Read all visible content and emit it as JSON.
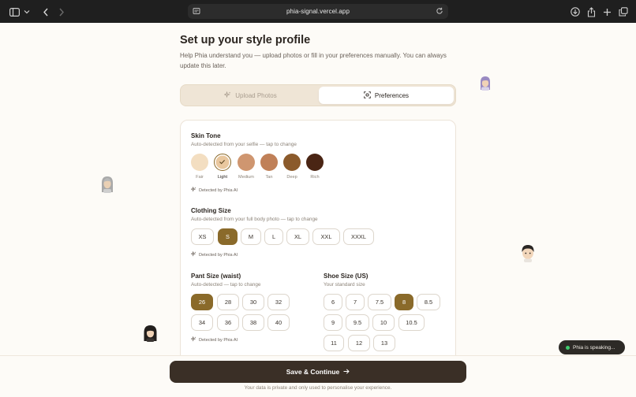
{
  "browser": {
    "url": "phia-signal.vercel.app"
  },
  "page": {
    "title": "Set up your style profile",
    "subtitle": "Help Phia understand you — upload photos or fill in your preferences manually. You can always update this later."
  },
  "tabs": [
    {
      "label": "Upload Photos",
      "icon": "sparkle-icon",
      "active": false
    },
    {
      "label": "Preferences",
      "icon": "scan-icon",
      "active": true
    }
  ],
  "skin_tone": {
    "heading": "Skin Tone",
    "description": "Auto-detected from your selfie — tap to change",
    "options": [
      {
        "label": "Fair",
        "color": "#f3dec1",
        "selected": false
      },
      {
        "label": "Light",
        "color": "#e9c79e",
        "selected": true
      },
      {
        "label": "Medium",
        "color": "#cf9670",
        "selected": false
      },
      {
        "label": "Tan",
        "color": "#c08058",
        "selected": false
      },
      {
        "label": "Deep",
        "color": "#8b5a2b",
        "selected": false
      },
      {
        "label": "Rich",
        "color": "#4a2514",
        "selected": false
      }
    ],
    "detected": "Detected by Phia AI"
  },
  "clothing_size": {
    "heading": "Clothing Size",
    "description": "Auto-detected from your full body photo — tap to change",
    "options": [
      "XS",
      "S",
      "M",
      "L",
      "XL",
      "XXL",
      "XXXL"
    ],
    "selected": "S",
    "detected": "Detected by Phia AI"
  },
  "pant_size": {
    "heading": "Pant Size (waist)",
    "description": "Auto-detected — tap to change",
    "options": [
      "26",
      "28",
      "30",
      "32",
      "34",
      "36",
      "38",
      "40"
    ],
    "selected": "26",
    "detected": "Detected by Phia AI"
  },
  "shoe_size": {
    "heading": "Shoe Size (US)",
    "description": "Your standard size",
    "options": [
      "6",
      "7",
      "7.5",
      "8",
      "8.5",
      "9",
      "9.5",
      "10",
      "10.5",
      "11",
      "12",
      "13"
    ],
    "selected": "8"
  },
  "footer": {
    "save_label": "Save & Continue",
    "privacy": "Your data is private and only used to personalise your experience."
  },
  "status": {
    "speaking": "Phia is speaking..."
  },
  "colors": {
    "accent": "#8a6a2a",
    "button_dark": "#3a2f26",
    "speaking_dot": "#3ecb6d"
  }
}
